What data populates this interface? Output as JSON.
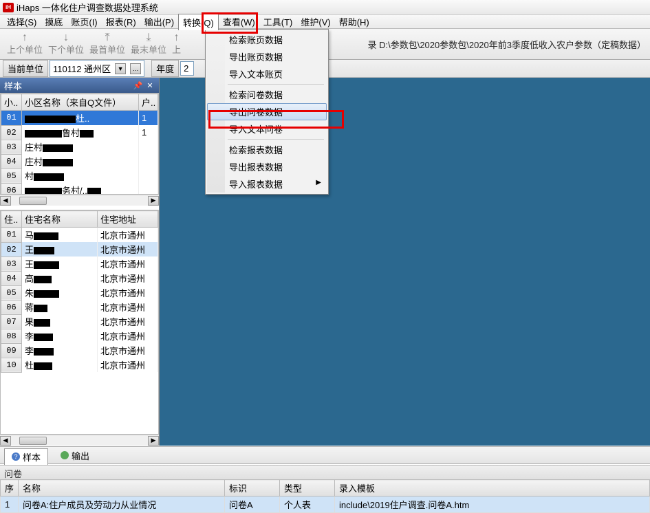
{
  "title": "iHaps 一体化住户调查数据处理系统",
  "menubar": [
    "选择(S)",
    "摸底",
    "账页(I)",
    "报表(R)",
    "输出(P)",
    "转换(Q)",
    "查看(W)",
    "工具(T)",
    "维护(V)",
    "帮助(H)"
  ],
  "menubar_open_index": 5,
  "dropdown": {
    "groups": [
      [
        "检索账页数据",
        "导出账页数据",
        "导入文本账页"
      ],
      [
        "检索问卷数据",
        "导出问卷数据",
        "导入文本问卷"
      ],
      [
        "检索报表数据",
        "导出报表数据",
        "导入报表数据"
      ]
    ],
    "hover_index": [
      1,
      1
    ],
    "submenu_index": [
      2,
      2
    ]
  },
  "toolbar": {
    "btns": [
      "上个单位",
      "下个单位",
      "最首单位",
      "最末单位",
      "上"
    ],
    "path_prefix": "录",
    "path": "D:\\参数包\\2020参数包\\2020年前3季度低收入农户参数（定稿数据）"
  },
  "unitbar": {
    "label": "当前单位",
    "unit": "110112 通州区",
    "year_label": "年度",
    "year": "2"
  },
  "side_panel_title": "样本",
  "top_grid": {
    "cols": [
      "小..",
      "小区名称（来自Q文件）",
      "户.."
    ],
    "rows": [
      {
        "idx": "01",
        "name_parts": [
          "",
          "",
          "杜.."
        ],
        "val": "1",
        "sel": true
      },
      {
        "idx": "02",
        "name_parts": [
          "",
          "鲁村",
          ""
        ],
        "val": "1"
      },
      {
        "idx": "03",
        "name_parts": [
          "庄村",
          "",
          ""
        ],
        "val": ""
      },
      {
        "idx": "04",
        "name_parts": [
          "庄村",
          "",
          ""
        ],
        "val": ""
      },
      {
        "idx": "05",
        "name_parts": [
          "村",
          "",
          ""
        ],
        "val": ""
      },
      {
        "idx": "06",
        "name_parts": [
          "",
          "务村/..",
          ""
        ],
        "val": ""
      }
    ]
  },
  "bottom_grid": {
    "cols": [
      "住..",
      "住宅名称",
      "住宅地址"
    ],
    "addr": "北京市通州",
    "rows": [
      {
        "idx": "01",
        "name": "马"
      },
      {
        "idx": "02",
        "name": "王",
        "sel": true
      },
      {
        "idx": "03",
        "name": "王"
      },
      {
        "idx": "04",
        "name": "高"
      },
      {
        "idx": "05",
        "name": "朱"
      },
      {
        "idx": "06",
        "name": "蒋"
      },
      {
        "idx": "07",
        "name": "果"
      },
      {
        "idx": "08",
        "name": "李"
      },
      {
        "idx": "09",
        "name": "李"
      },
      {
        "idx": "10",
        "name": "杜"
      }
    ]
  },
  "tabs": {
    "sample": "样本",
    "output": "输出"
  },
  "wenjuan": {
    "header": "问卷",
    "cols": [
      "序",
      "名称",
      "标识",
      "类型",
      "录入模板"
    ],
    "row": {
      "idx": "1",
      "name": "问卷A:住户成员及劳动力从业情况",
      "biaoshi": "问卷A",
      "leixing": "个人表",
      "moban": "include\\2019住户调查.问卷A.htm"
    }
  }
}
